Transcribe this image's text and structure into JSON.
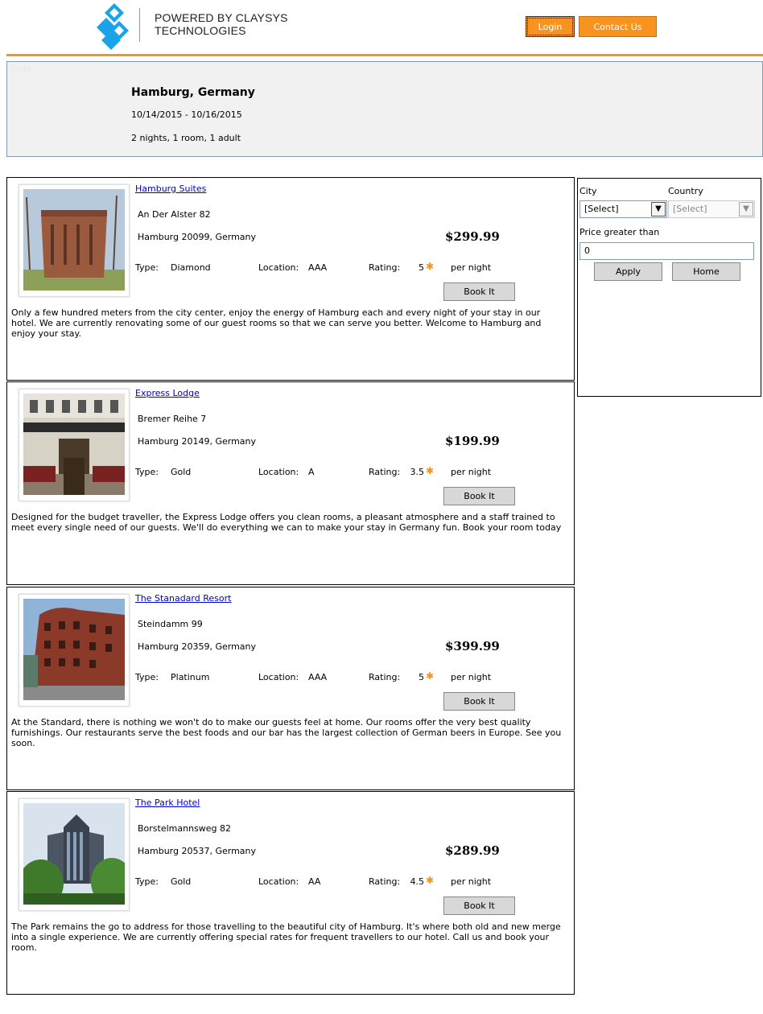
{
  "header": {
    "brand_line1": "POWERED BY CLAYSYS",
    "brand_line2": "TECHNOLOGIES",
    "login_label": "Login",
    "contact_label": "Contact Us"
  },
  "summary": {
    "hidden_label": "Hide",
    "destination": "Hamburg, Germany",
    "dates": "10/14/2015 - 10/16/2015",
    "stay": "2 nights, 1 room, 1 adult"
  },
  "labels": {
    "type": "Type:",
    "location": "Location:",
    "rating": "Rating:",
    "per_night": "per night",
    "book": "Book It"
  },
  "hotels": [
    {
      "name": "Hamburg Suites",
      "street": "An Der Alster 82",
      "city": "Hamburg 20099, Germany",
      "price": "$299.99",
      "type": "Diamond",
      "location": "AAA",
      "rating": "5",
      "description": "Only a few hundred meters from the city center, enjoy the energy of Hamburg each and every night of your stay in our hotel. We are currently renovating some of our guest rooms so that we can serve you better. Welcome to Hamburg and enjoy your stay."
    },
    {
      "name": "Express Lodge",
      "street": "Bremer Reihe 7",
      "city": "Hamburg 20149, Germany",
      "price": "$199.99",
      "type": "Gold",
      "location": "A",
      "rating": "3.5",
      "description": "Designed for the budget traveller, the Express Lodge offers you clean rooms, a pleasant atmosphere and a staff trained to meet every single need of our guests. We'll do everything we can to make your stay in Germany fun. Book your room today"
    },
    {
      "name": "The Stanadard Resort",
      "street": "Steindamm 99",
      "city": "Hamburg 20359, Germany",
      "price": "$399.99",
      "type": "Platinum",
      "location": "AAA",
      "rating": "5",
      "description": "At the Standard, there is nothing we won't do to make our guests feel at home. Our rooms offer the very best quality furnishings. Our restaurants serve the best foods and our bar has the largest collection of German beers in Europe. See you soon."
    },
    {
      "name": "The Park Hotel",
      "street": "Borstelmannsweg 82",
      "city": "Hamburg 20537, Germany",
      "price": "$289.99",
      "type": "Gold",
      "location": "AA",
      "rating": "4.5",
      "description": "The Park remains the go to address for those travelling to the beautiful city of Hamburg. It's where both old and new merge into a single experience. We are currently offering special rates for frequent travellers to our hotel. Call us and book your room."
    }
  ],
  "filter": {
    "city_label": "City",
    "city_value": "[Select]",
    "country_label": "Country",
    "country_value": "[Select]",
    "price_label": "Price greater than",
    "price_value": "0",
    "apply_label": "Apply",
    "home_label": "Home"
  },
  "colors": {
    "accent": "#f7931e",
    "link": "#0000cc",
    "brand_blue": "#1aa3e8"
  }
}
